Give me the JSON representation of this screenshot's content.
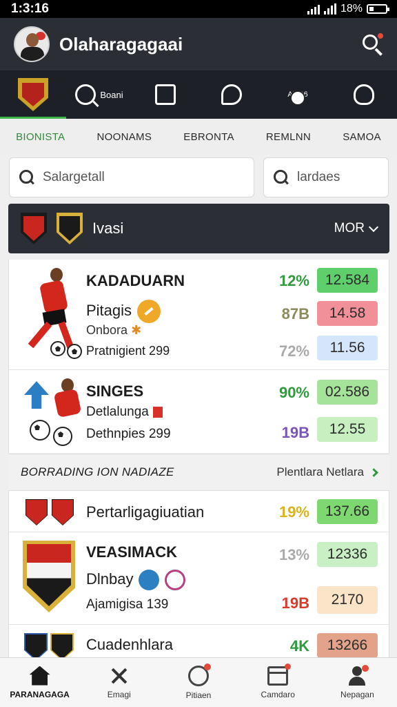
{
  "status_bar": {
    "time": "1:3:16",
    "battery": "18%"
  },
  "header": {
    "title": "Olaharagagaai"
  },
  "icon_nav": {
    "items": [
      {
        "icon": "team-crest-icon"
      },
      {
        "icon": "search-icon",
        "label": "Boani"
      },
      {
        "icon": "board-icon"
      },
      {
        "icon": "whistle-icon"
      },
      {
        "icon": "ball-icon",
        "label": "ADR6"
      },
      {
        "icon": "trophy-icon"
      }
    ]
  },
  "tabs": [
    "BIONISTA",
    "NOONAMS",
    "EBRONTA",
    "REMLNN",
    "SAMOA"
  ],
  "search": {
    "main_placeholder": "Salargetall",
    "side_placeholder": "lardaes"
  },
  "league": {
    "name": "Ivasi",
    "more_label": "MOR"
  },
  "matches": [
    {
      "title": "KADADUARN",
      "sub1": "Pitagis",
      "sub2": "Onbora",
      "sub3": "Pratnigient 299",
      "odds": [
        {
          "pct": "12%",
          "pct_color": "#2f9a3e",
          "value": "12.584",
          "bg": "#5fcf6b"
        },
        {
          "pct": "87B",
          "pct_color": "#8a8a5a",
          "value": "14.58",
          "bg": "#f2909a"
        },
        {
          "pct": "72%",
          "pct_color": "#aaaaaa",
          "value": "11.56",
          "bg": "#d5e6fb"
        }
      ]
    },
    {
      "title": "SINGES",
      "sub1": "Detlalunga",
      "sub2": "Dethnpies 299",
      "odds": [
        {
          "pct": "90%",
          "pct_color": "#2f9a3e",
          "value": "02.586",
          "bg": "#a5e39a"
        },
        {
          "pct": "19B",
          "pct_color": "#7a55b8",
          "value": "12.55",
          "bg": "#c8efc0"
        }
      ]
    }
  ],
  "section": {
    "title": "BORRADING ION NADIAZE",
    "link": "Plentlara Netlara"
  },
  "rows": [
    {
      "title": "Pertarligagiuatian",
      "pct": "19%",
      "pct_color": "#d9b21c",
      "value": "137.66",
      "bg": "#7ed870"
    },
    {
      "title": "VEASIMACK",
      "sub1": "Dlnbay",
      "sub2": "Ajamigisa 139",
      "odds": [
        {
          "pct": "13%",
          "pct_color": "#aaaaaa",
          "value": "12336",
          "bg": "#c9efc5"
        },
        {
          "pct": "19B",
          "pct_color": "#d53a2b",
          "value": "2170",
          "bg": "#fbe4c7"
        }
      ]
    },
    {
      "title": "Cuadenhlara",
      "pct": "4K",
      "pct_color": "#2f9a3e",
      "value": "13266",
      "bg": "#e3a28a"
    }
  ],
  "bottom_nav": [
    {
      "label": "PARANAGAGA",
      "icon": "home-icon"
    },
    {
      "label": "Emagi",
      "icon": "close-icon"
    },
    {
      "label": "Pitiaen",
      "icon": "clock-icon"
    },
    {
      "label": "Camdaro",
      "icon": "calendar-icon"
    },
    {
      "label": "Nepagan",
      "icon": "profile-icon"
    }
  ]
}
